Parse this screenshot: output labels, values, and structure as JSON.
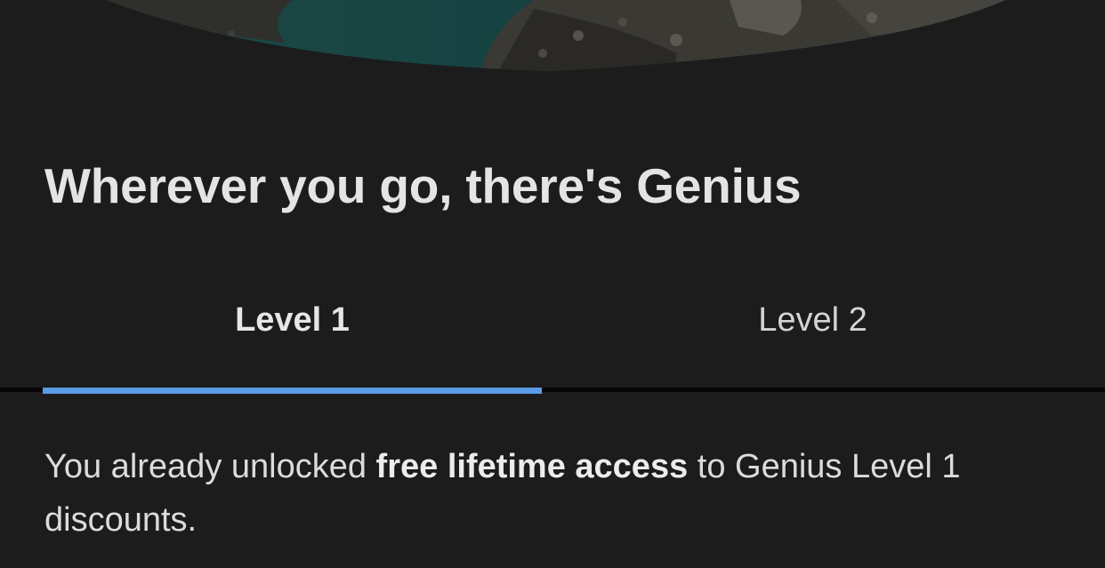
{
  "page": {
    "title": "Wherever you go, there's Genius"
  },
  "tabs": [
    {
      "label": "Level 1",
      "selected": true
    },
    {
      "label": "Level 2",
      "selected": false
    }
  ],
  "description": {
    "prefix": "You already unlocked ",
    "emphasis": "free lifetime access",
    "suffix": " to Genius Level 1 discounts."
  },
  "colors": {
    "background": "#1c1c1c",
    "accent": "#5a9be6",
    "text": "#e2e2e2"
  }
}
